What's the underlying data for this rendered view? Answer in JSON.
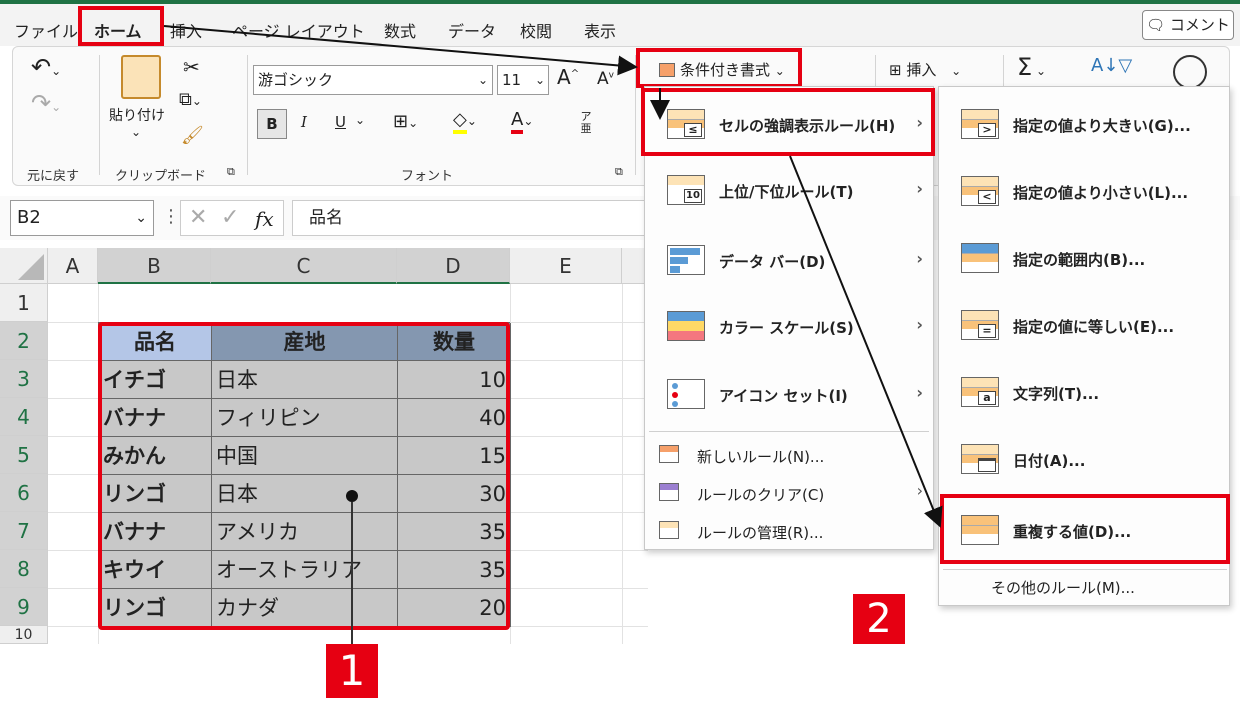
{
  "menu_tabs": [
    "ファイル",
    "ホーム",
    "挿入",
    "ページ レイアウト",
    "数式",
    "データ",
    "校閲",
    "表示"
  ],
  "comment_button": "コメント",
  "ribbon": {
    "undo_label": "元に戻す",
    "clipboard_label": "クリップボード",
    "paste_label": "貼り付け",
    "font_label": "フォント",
    "font_name": "游ゴシック",
    "font_size": "11",
    "bold": "B",
    "italic": "I",
    "underline": "U",
    "grow_font": "A",
    "shrink_font": "A",
    "furigana": "ア亜",
    "conditional_format": "条件付き書式",
    "insert": "挿入",
    "sum_icon": "Σ"
  },
  "formula_bar": {
    "name_box": "B2",
    "fx": "fx",
    "content": "品名"
  },
  "columns": [
    "A",
    "B",
    "C",
    "D",
    "E"
  ],
  "rows": [
    "1",
    "2",
    "3",
    "4",
    "5",
    "6",
    "7",
    "8",
    "9"
  ],
  "table": {
    "headers": [
      "品名",
      "産地",
      "数量"
    ],
    "rows": [
      [
        "イチゴ",
        "日本",
        "10"
      ],
      [
        "バナナ",
        "フィリピン",
        "40"
      ],
      [
        "みかん",
        "中国",
        "15"
      ],
      [
        "リンゴ",
        "日本",
        "30"
      ],
      [
        "バナナ",
        "アメリカ",
        "35"
      ],
      [
        "キウイ",
        "オーストラリア",
        "35"
      ],
      [
        "リンゴ",
        "カナダ",
        "20"
      ]
    ]
  },
  "cf_menu": {
    "items": [
      "セルの強調表示ルール(H)",
      "上位/下位ルール(T)",
      "データ バー(D)",
      "カラー スケール(S)",
      "アイコン セット(I)"
    ],
    "small_items": [
      "新しいルール(N)...",
      "ルールのクリア(C)",
      "ルールの管理(R)..."
    ]
  },
  "submenu": {
    "items": [
      "指定の値より大きい(G)...",
      "指定の値より小さい(L)...",
      "指定の範囲内(B)...",
      "指定の値に等しい(E)...",
      "文字列(T)...",
      "日付(A)...",
      "重複する値(D)..."
    ],
    "other": "その他のルール(M)..."
  },
  "callouts": [
    "1",
    "2"
  ],
  "colors": {
    "highlight": "#e60012",
    "header_fill": "#8497b0",
    "header_fill_b": "#b4c6e7",
    "cell_fill": "#c8c8c8",
    "excel_green": "#1f7244"
  }
}
